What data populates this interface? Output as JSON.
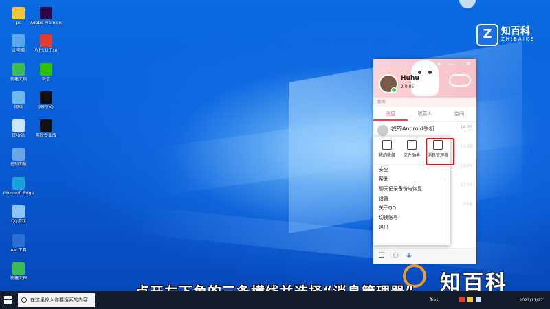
{
  "desktop": {
    "icons": [
      {
        "label": "pc",
        "name": "pc-icon",
        "color": "#f3c53a"
      },
      {
        "label": "Adobe Premiere...",
        "name": "premiere-icon",
        "color": "#2a0a4a"
      },
      {
        "label": "此电脑",
        "name": "this-pc-icon",
        "color": "#5aa9e6"
      },
      {
        "label": "WPS Office",
        "name": "wps-icon",
        "color": "#e33b2e"
      },
      {
        "label": "新建文档",
        "name": "new-doc-icon",
        "color": "#3dbb55"
      },
      {
        "label": "微信",
        "name": "wechat-icon",
        "color": "#2dc100"
      },
      {
        "label": "网络",
        "name": "network-icon",
        "color": "#6fb7f0"
      },
      {
        "label": "腾讯QQ",
        "name": "qq-desktop-icon",
        "color": "#111"
      },
      {
        "label": "回收站",
        "name": "recycle-bin-icon",
        "color": "#cfe4f7"
      },
      {
        "label": "剪映专业版",
        "name": "jianying-icon",
        "color": "#111"
      },
      {
        "label": "控制面板",
        "name": "control-panel-icon",
        "color": "#6aa6e8"
      },
      {
        "label": "Microsoft Edge",
        "name": "edge-icon",
        "color": "#1aa0d8"
      },
      {
        "label": "QQ游戏",
        "name": "qq-game-icon",
        "color": "#8cc6f5"
      },
      {
        "label": "AM 工具",
        "name": "am-tool-icon",
        "color": "#2d6fd0"
      },
      {
        "label": "新建文档",
        "name": "new-doc2-icon",
        "color": "#3dbb55"
      }
    ]
  },
  "watermark_top": {
    "logo": "Z",
    "title": "知百科",
    "sub": "ZHIBAIKE"
  },
  "qq": {
    "username": "Huhu",
    "signature": "2.0.05",
    "search_placeholder": "搜索",
    "tabs": [
      "消息",
      "联系人",
      "空间"
    ],
    "messages": [
      {
        "name": "我的Android手机",
        "time": "14:31"
      },
      {
        "time": "14:15"
      },
      {
        "time": "13:42"
      },
      {
        "time": "11:55"
      },
      {
        "time": "9:58"
      }
    ],
    "controls": {
      "add": "+",
      "min": "—",
      "close": "✕"
    }
  },
  "menu": {
    "tools": [
      "我的收藏",
      "文件助手",
      "消息管理器"
    ],
    "items": [
      "安全",
      "帮助",
      "聊天记录备份与恢复",
      "设置",
      "关于QQ",
      "切换账号",
      "退出"
    ]
  },
  "subtitle": "点开左下角的三条横线并选择“消息管理器”",
  "watermark_bottom": {
    "text": "知百科"
  },
  "taskbar": {
    "search_placeholder": "在这里输入你要搜索的内容",
    "weather": "多云",
    "date": "2021/11/27"
  }
}
